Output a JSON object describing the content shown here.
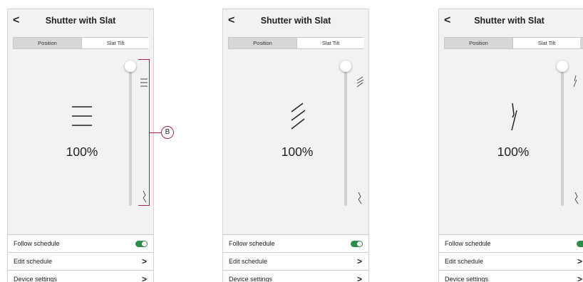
{
  "screens": [
    {
      "title": "Shutter with Slat",
      "tabs": [
        {
          "label": "Position"
        },
        {
          "label": "Slat Tilt"
        }
      ],
      "percent": "100%",
      "slider_level": 1.0,
      "rows": [
        {
          "label": "Follow schedule",
          "control": "toggle-on"
        },
        {
          "label": "Edit schedule",
          "control": "chevron"
        },
        {
          "label": "Device settings",
          "control": "chevron"
        }
      ]
    },
    {
      "title": "Shutter with Slat",
      "tabs": [
        {
          "label": "Position"
        },
        {
          "label": "Slat Tilt"
        }
      ],
      "percent": "100%",
      "slider_level": 1.0,
      "rows": [
        {
          "label": "Follow schedule",
          "control": "toggle-on"
        },
        {
          "label": "Edit schedule",
          "control": "chevron"
        },
        {
          "label": "Device settings",
          "control": "chevron"
        }
      ]
    },
    {
      "title": "Shutter with Slat",
      "tabs": [
        {
          "label": "Position"
        },
        {
          "label": "Slat Tilt"
        }
      ],
      "percent": "100%",
      "slider_level": 1.0,
      "rows": [
        {
          "label": "Follow schedule",
          "control": "toggle-on"
        },
        {
          "label": "Edit schedule",
          "control": "chevron"
        },
        {
          "label": "Device settings",
          "control": "chevron"
        }
      ]
    }
  ],
  "glyphs": {
    "back": "<",
    "chevron": ">"
  },
  "callout": {
    "label": "B",
    "color": "#a6264a"
  },
  "colors": {
    "toggle_on": "#2e8b4a",
    "background": "#f2f2f2"
  }
}
